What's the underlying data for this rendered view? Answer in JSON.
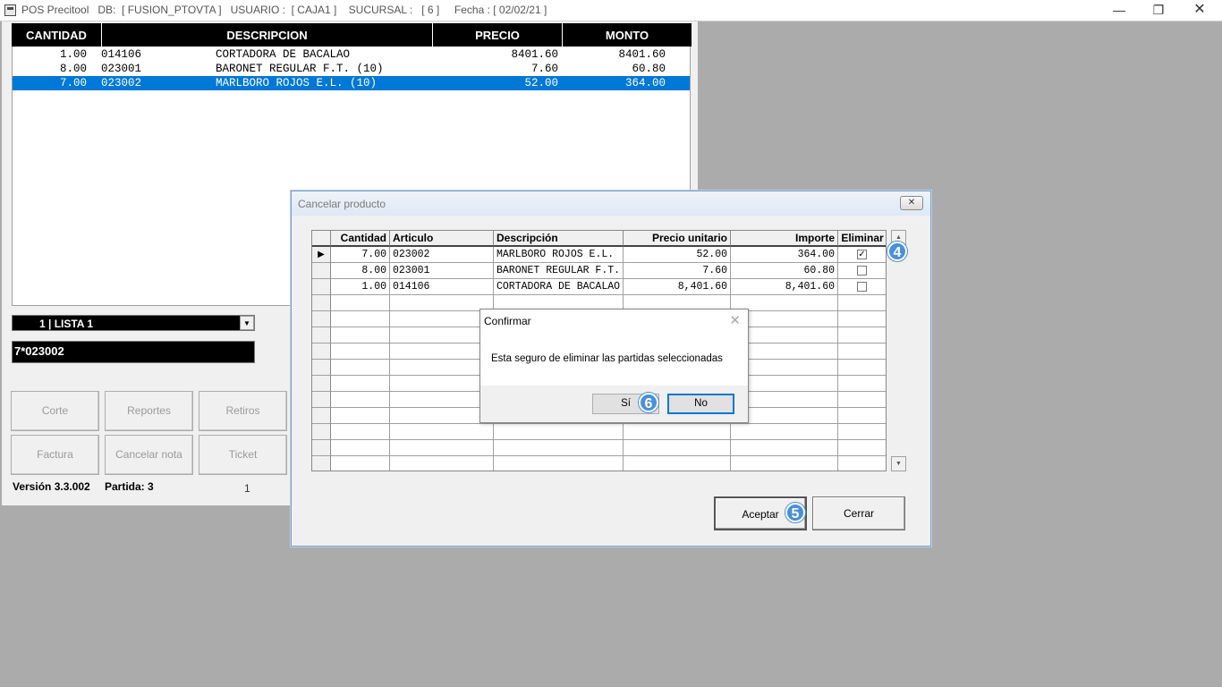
{
  "titlebar": {
    "text": "POS Precitool   DB:  [ FUSION_PTOVTA ]   USUARIO :  [ CAJA1 ]    SUCURSAL :   [ 6 ]     Fecha : [ 02/02/21 ]"
  },
  "main_grid": {
    "headers": [
      "CANTIDAD",
      "DESCRIPCION",
      "PRECIO",
      "MONTO"
    ],
    "rows": [
      {
        "cantidad": "1.00",
        "articulo": "014106",
        "descripcion": "CORTADORA DE BACALAO",
        "precio": "8401.60",
        "monto": "8401.60"
      },
      {
        "cantidad": "8.00",
        "articulo": "023001",
        "descripcion": "BARONET REGULAR F.T. (10)",
        "precio": "7.60",
        "monto": "60.80"
      },
      {
        "cantidad": "7.00",
        "articulo": "023002",
        "descripcion": "MARLBORO ROJOS E.L. (10)",
        "precio": "52.00",
        "monto": "364.00"
      }
    ]
  },
  "lista": {
    "selected": "1  | LISTA 1"
  },
  "code_input": {
    "value": "7*023002"
  },
  "buttons": {
    "corte": "Corte",
    "reportes": "Reportes",
    "retiros": "Retiros",
    "factura": "Factura",
    "cancelar_nota": "Cancelar nota",
    "ticket": "Ticket"
  },
  "status": {
    "version": "Versión 3.3.002",
    "partida": "Partida: 3",
    "count": "1"
  },
  "cancel_dialog": {
    "title": "Cancelar producto",
    "headers": [
      "Cantidad",
      "Articulo",
      "Descripción",
      "Precio unitario",
      "Importe",
      "Eliminar"
    ],
    "rows": [
      {
        "cantidad": "7.00",
        "articulo": "023002",
        "descripcion": "MARLBORO ROJOS E.L.",
        "precio": "52.00",
        "importe": "364.00",
        "eliminar": true
      },
      {
        "cantidad": "8.00",
        "articulo": "023001",
        "descripcion": "BARONET REGULAR F.T.",
        "precio": "7.60",
        "importe": "60.80",
        "eliminar": false
      },
      {
        "cantidad": "1.00",
        "articulo": "014106",
        "descripcion": "CORTADORA DE BACALAO",
        "precio": "8,401.60",
        "importe": "8,401.60",
        "eliminar": false
      }
    ],
    "aceptar": "Aceptar",
    "cerrar": "Cerrar"
  },
  "confirm_dialog": {
    "title": "Confirmar",
    "message": "Esta seguro de eliminar las partidas seleccionadas",
    "yes": "Sí",
    "no": "No"
  },
  "badges": {
    "b4": "4",
    "b5": "5",
    "b6": "6"
  },
  "colors": {
    "selection": "#0078d7",
    "badge": "#4a90d9"
  }
}
